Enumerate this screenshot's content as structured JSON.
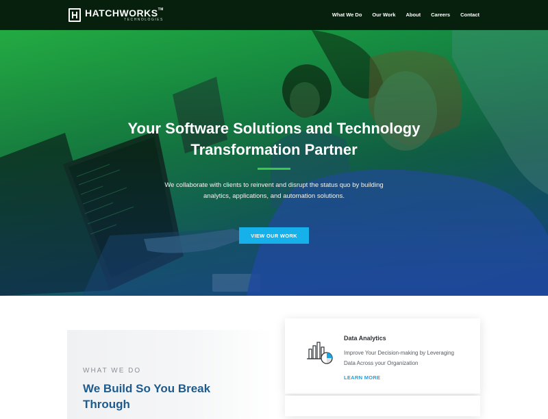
{
  "brand": {
    "name": "HATCHWORKS",
    "tm": "TM",
    "sub": "TECHNOLOGIES"
  },
  "nav": {
    "items": [
      "What We Do",
      "Our Work",
      "About",
      "Careers",
      "Contact"
    ]
  },
  "hero": {
    "title": "Your Software Solutions and Technology Transformation Partner",
    "description": "We collaborate with clients to reinvent and disrupt the status quo by building analytics, applications, and automation solutions.",
    "button": "VIEW OUR WORK",
    "accent": "#3ac94a",
    "button_color": "#16b1ea"
  },
  "what_we_do": {
    "eyebrow": "WHAT WE DO",
    "title": "We Build So You Break Through"
  },
  "card": {
    "icon": "analytics-chart-icon",
    "title": "Data Analytics",
    "description": "Improve Your Decision-making by Leveraging Data Across your Organization",
    "link": "LEARN MORE",
    "link_color": "#1aa3df"
  }
}
